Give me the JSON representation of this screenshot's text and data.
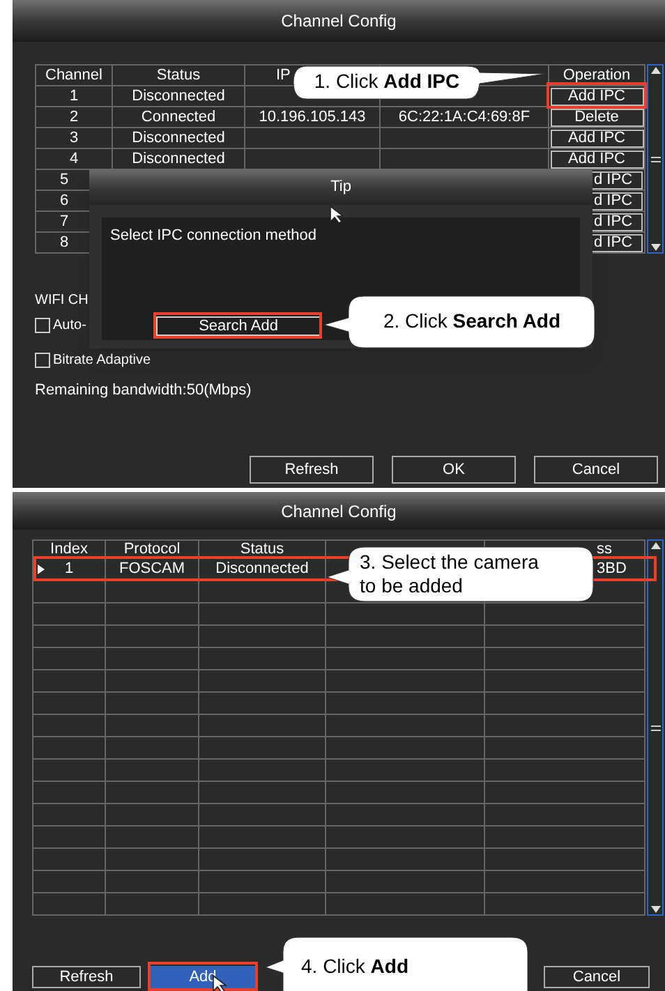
{
  "top_window": {
    "title": "Channel Config",
    "table": {
      "columns": [
        {
          "label": "Channel"
        },
        {
          "label": "Status"
        },
        {
          "label": "IP"
        },
        {},
        {
          "label": "Operation"
        }
      ],
      "rows": [
        {
          "kind": "full",
          "channel": "1",
          "status": "Disconnected",
          "operation": "Add IPC"
        },
        {
          "kind": "full",
          "channel": "2",
          "status": "Connected",
          "ip": "10.196.105.143",
          "mac": "6C:22:1A:C4:69:8F",
          "operation": "Delete"
        },
        {
          "kind": "full",
          "channel": "3",
          "status": "Disconnected",
          "operation": "Add IPC"
        },
        {
          "kind": "full",
          "channel": "4",
          "status": "Disconnected",
          "operation": "Add IPC"
        },
        {
          "kind": "covered",
          "channel": "5",
          "operation": "d IPC"
        },
        {
          "kind": "covered",
          "channel": "6",
          "operation": "d IPC"
        },
        {
          "kind": "covered",
          "channel": "7",
          "operation": "d IPC"
        },
        {
          "kind": "covered",
          "channel": "8",
          "operation": "d IPC"
        }
      ]
    },
    "wifi_label": "WIFI CH",
    "checkboxes": [
      {
        "label": "Auto-",
        "checked": false
      },
      {
        "label": "Bitrate Adaptive",
        "checked": false
      }
    ],
    "bandwidth": "Remaining bandwidth:50(Mbps)",
    "buttons": [
      "Refresh",
      "OK",
      "Cancel"
    ],
    "dialog": {
      "title": "Tip",
      "message": "Select IPC connection method",
      "button": "Search Add"
    }
  },
  "bottom_window": {
    "title": "Channel Config",
    "table": {
      "columns": [
        {
          "label": "Index"
        },
        {
          "label": "Protocol"
        },
        {
          "label": "Status"
        },
        {},
        {
          "label": "ss"
        }
      ],
      "rows": [
        {
          "selected": true,
          "index": "1",
          "protocol": "FOSCAM",
          "status": "Disconnected",
          "column_5": "3BD"
        }
      ]
    },
    "buttons": [
      {
        "label": "Refresh",
        "selected": false
      },
      {
        "label": "Add",
        "selected": true
      },
      {
        "label": "Cancel",
        "selected": false
      }
    ]
  },
  "annotations": [
    {
      "text": "1. Click **Add IPC**"
    },
    {
      "text": "2. Click **Search Add**"
    },
    {
      "text": "3. Select the camera to be added"
    },
    {
      "text": "4. Click **Add**"
    }
  ]
}
